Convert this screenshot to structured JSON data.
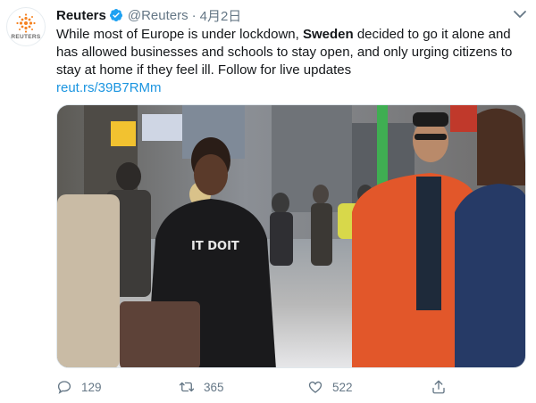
{
  "tweet": {
    "author_name": "Reuters",
    "author_handle": "@Reuters",
    "separator": "·",
    "date": "4月2日",
    "avatar_logo_text": "REUTERS",
    "text_part1": "While most of Europe is under lockdown, ",
    "text_bold": "Sweden",
    "text_part2": " decided to go it alone and has allowed businesses and schools to stay open, and only urging citizens to stay at home if they feel ill. Follow for live updates",
    "link": "reut.rs/39B7RMm",
    "media": {
      "overlay_text": "IT DOIT",
      "description_icon": "video-thumbnail"
    }
  },
  "actions": {
    "reply_count": "129",
    "retweet_count": "365",
    "like_count": "522"
  },
  "colors": {
    "link": "#1b95e0",
    "verified": "#1da1f2",
    "secondary_text": "#657786",
    "jacket_orange": "#e2572a",
    "reuters_orange": "#f58220"
  },
  "icons": [
    "reuters-logo-icon",
    "verified-badge-icon",
    "caret-down-icon",
    "reply-icon",
    "retweet-icon",
    "like-icon",
    "share-icon"
  ]
}
